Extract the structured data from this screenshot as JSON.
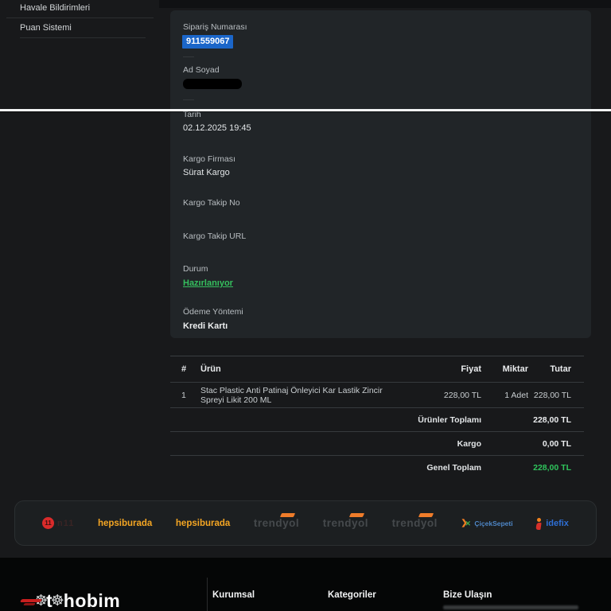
{
  "sidebar": {
    "items": [
      {
        "label": "Havale Bildirimleri"
      },
      {
        "label": "Puan Sistemi"
      }
    ]
  },
  "order_details": {
    "fields": [
      {
        "label": "Sipariş Numarası",
        "value": "911559067",
        "style": "selected"
      },
      {
        "label": "Ad Soyad",
        "value": "",
        "style": "redacted"
      },
      {
        "label": "Tarih",
        "value": "02.12.2025 19:45",
        "style": "plain"
      },
      {
        "label": "Kargo Firması",
        "value": "Sürat Kargo",
        "style": "plain"
      },
      {
        "label": "Kargo Takip No",
        "value": "",
        "style": "empty"
      },
      {
        "label": "Kargo Takip URL",
        "value": "",
        "style": "empty"
      },
      {
        "label": "Durum",
        "value": "Hazırlanıyor",
        "style": "status-green"
      },
      {
        "label": "Ödeme Yöntemi",
        "value": "Kredi Kartı",
        "style": "bold"
      }
    ]
  },
  "items_table": {
    "headers": {
      "index": "#",
      "product": "Ürün",
      "price": "Fiyat",
      "qty": "Miktar",
      "total": "Tutar"
    },
    "rows": [
      {
        "index": "1",
        "product": "Stac Plastic Anti Patinaj Önleyici Kar Lastik Zincir Spreyi Likit 200 ML",
        "price": "228,00 TL",
        "qty": "1 Adet",
        "total": "228,00 TL"
      }
    ],
    "summary": [
      {
        "label": "Ürünler Toplamı",
        "value": "228,00 TL",
        "style": "plain"
      },
      {
        "label": "Kargo",
        "value": "0,00 TL",
        "style": "plain"
      },
      {
        "label": "Genel Toplam",
        "value": "228,00 TL",
        "style": "green"
      }
    ]
  },
  "marketplaces": {
    "logos": [
      {
        "icon": "n11-logo",
        "circle": "11",
        "text": "n11"
      },
      {
        "icon": "hepsiburada-logo",
        "text": "hepsiburada"
      },
      {
        "icon": "hepsiburada-logo",
        "text": "hepsiburada"
      },
      {
        "icon": "trendyol-logo",
        "text": "trendyol"
      },
      {
        "icon": "trendyol-logo",
        "text": "trendyol"
      },
      {
        "icon": "trendyol-logo",
        "text": "trendyol"
      },
      {
        "icon": "ciceksepeti-logo",
        "text": "ÇiçekSepeti"
      },
      {
        "icon": "idefix-logo",
        "text": "idefix"
      }
    ]
  },
  "footer": {
    "brand": {
      "part_t": "t",
      "part_rest": "hobim"
    },
    "columns": [
      {
        "heading": "Kurumsal"
      },
      {
        "heading": "Kategoriler"
      },
      {
        "heading": "Bize Ulaşın"
      }
    ]
  },
  "colors": {
    "accent_blue_selection": "#1b66c9",
    "status_green": "#35c05e",
    "total_green": "#2fc45c",
    "hepsiburada_orange": "#f5a623",
    "trendyol_orange": "#ef7c2a",
    "n11_red": "#d92b2b",
    "idefix_blue": "#2e6fd6",
    "card_bg": "#212528",
    "page_bg": "#18191b",
    "footer_bg": "#050606"
  }
}
